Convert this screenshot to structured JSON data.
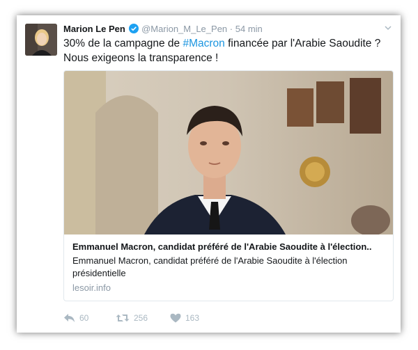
{
  "tweet": {
    "author_name": "Marion Le Pen",
    "author_handle": "@Marion_M_Le_Pen",
    "separator": "·",
    "timestamp": "54 min",
    "text_before": "30% de la campagne de ",
    "hashtag": "#Macron",
    "text_after": " financée par l'Arabie Saoudite ? Nous exigeons la transparence !"
  },
  "card": {
    "title": "Emmanuel Macron, candidat préféré de l'Arabie Saoudite à l'élection..",
    "description": "Emmanuel Macron, candidat préféré de l'Arabie Saoudite à l'élection présidentielle",
    "domain": "lesoir.info"
  },
  "actions": {
    "replies": "60",
    "retweets": "256",
    "likes": "163"
  },
  "icons": {
    "verified": "verified-badge-icon",
    "menu": "chevron-down-icon",
    "reply": "reply-icon",
    "retweet": "retweet-icon",
    "like": "heart-icon"
  },
  "colors": {
    "link": "#1b95e0",
    "text": "#14171a",
    "muted": "#8b98a5",
    "action": "#aab8c2",
    "border": "#e1e8ed"
  }
}
